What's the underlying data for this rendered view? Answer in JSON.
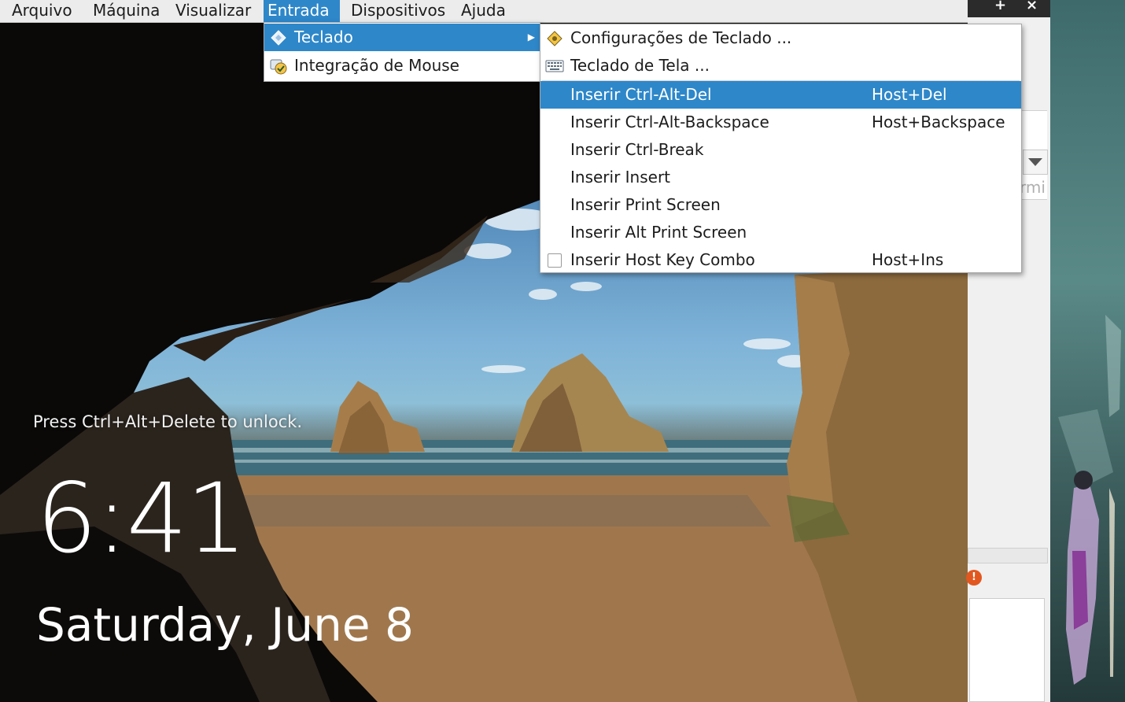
{
  "menubar": {
    "items": [
      "Arquivo",
      "Máquina",
      "Visualizar",
      "Entrada",
      "Dispositivos",
      "Ajuda"
    ],
    "active_item": "Entrada"
  },
  "entrada_menu": {
    "items": [
      {
        "label": "Teclado",
        "icon": "keyboard-diamond-icon",
        "has_submenu": true,
        "highlighted": true
      },
      {
        "label": "Integração de Mouse",
        "icon": "mouse-integration-icon",
        "has_submenu": false,
        "highlighted": false
      }
    ]
  },
  "teclado_submenu": {
    "items": [
      {
        "label": "Configurações de Teclado ...",
        "icon": "keyboard-settings-icon",
        "shortcut": ""
      },
      {
        "label": "Teclado de Tela ...",
        "icon": "onscreen-keyboard-icon",
        "shortcut": ""
      },
      {
        "label": "Inserir Ctrl-Alt-Del",
        "shortcut": "Host+Del",
        "highlighted": true
      },
      {
        "label": "Inserir Ctrl-Alt-Backspace",
        "shortcut": "Host+Backspace"
      },
      {
        "label": "Inserir Ctrl-Break",
        "shortcut": ""
      },
      {
        "label": "Inserir Insert",
        "shortcut": ""
      },
      {
        "label": "Inserir Print Screen",
        "shortcut": ""
      },
      {
        "label": "Inserir Alt Print Screen",
        "shortcut": ""
      },
      {
        "label": "Inserir Host Key Combo",
        "shortcut": "Host+Ins",
        "checkbox": true,
        "checked": false
      }
    ]
  },
  "lock_screen": {
    "hint": "Press Ctrl+Alt+Delete to unlock.",
    "time": "6:41",
    "date": "Saturday, June 8"
  },
  "host_window": {
    "partial_text": "rmi",
    "title_buttons": [
      "+",
      "×"
    ],
    "warning_badge": "!"
  },
  "colors": {
    "menu_highlight": "#2e87c9",
    "menubar_bg": "#ececec",
    "warning": "#e2571f"
  }
}
